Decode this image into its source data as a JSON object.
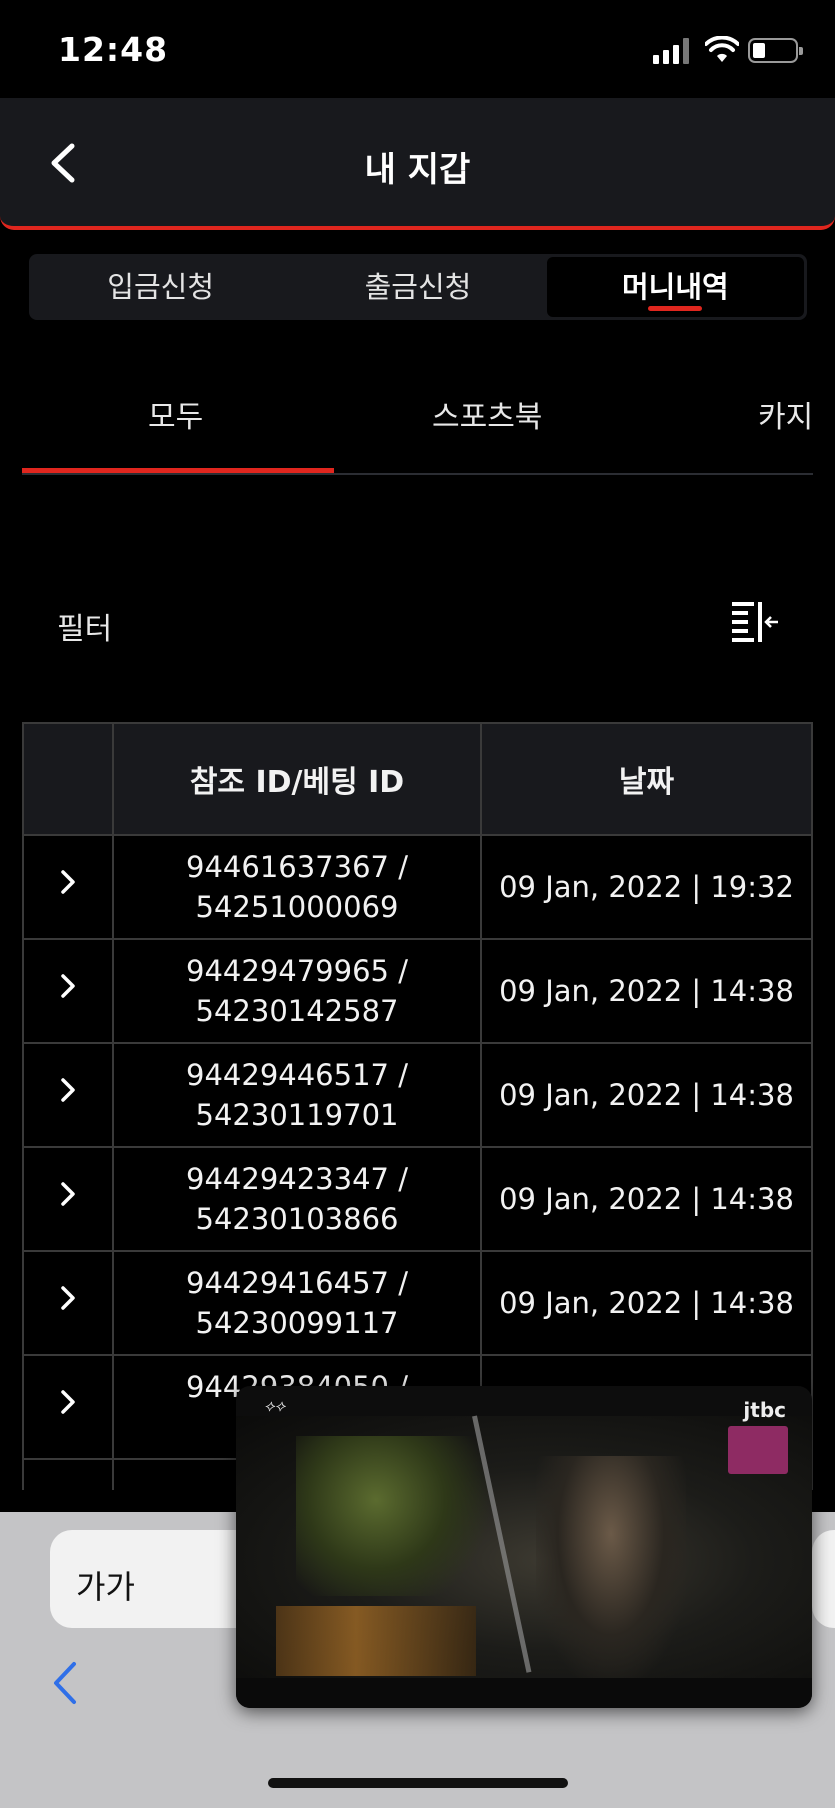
{
  "status_bar": {
    "time": "12:48"
  },
  "header": {
    "title": "내 지갑"
  },
  "wallet_tabs": [
    {
      "label": "입금신청",
      "active": false
    },
    {
      "label": "출금신청",
      "active": false
    },
    {
      "label": "머니내역",
      "active": true
    }
  ],
  "category_tabs": [
    {
      "label": "모두",
      "active": true
    },
    {
      "label": "스포츠북",
      "active": false
    },
    {
      "label": "카지",
      "active": false
    }
  ],
  "filter": {
    "label": "필터"
  },
  "table": {
    "headers": [
      "",
      "참조 ID/베팅 ID",
      "날짜"
    ],
    "rows": [
      {
        "ref_id": "94461637367 /",
        "bet_id": "54251000069",
        "date": "09 Jan, 2022 | 19:32"
      },
      {
        "ref_id": "94429479965 /",
        "bet_id": "54230142587",
        "date": "09 Jan, 2022 | 14:38"
      },
      {
        "ref_id": "94429446517 /",
        "bet_id": "54230119701",
        "date": "09 Jan, 2022 | 14:38"
      },
      {
        "ref_id": "94429423347 /",
        "bet_id": "54230103866",
        "date": "09 Jan, 2022 | 14:38"
      },
      {
        "ref_id": "94429416457 /",
        "bet_id": "54230099117",
        "date": "09 Jan, 2022 | 14:38"
      },
      {
        "ref_id": "94429384050 /",
        "bet_id": "54",
        "date": ""
      }
    ]
  },
  "browser": {
    "text_size_label": "가가"
  },
  "pip_video": {
    "channel": "jtbc"
  },
  "colors": {
    "accent": "#e0261e",
    "surface": "#18191d",
    "background": "#000000"
  }
}
